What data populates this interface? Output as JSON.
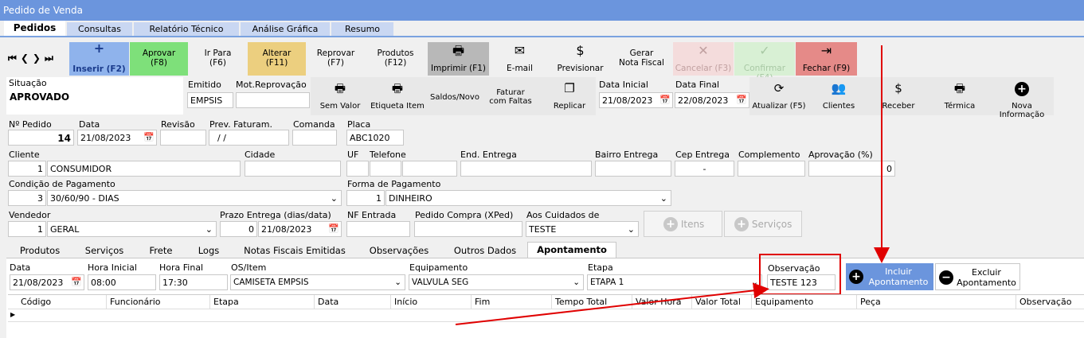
{
  "window": {
    "title": "Pedido de Venda"
  },
  "main_tabs": [
    "Pedidos",
    "Consultas",
    "Relatório Técnico",
    "Análise Gráfica",
    "Resumo"
  ],
  "toolbar": {
    "nav": [
      "⏮",
      "❮",
      "❯",
      "⏭"
    ],
    "insert": "Inserir (F2)",
    "approve_1": "Aprovar",
    "approve_2": "(F8)",
    "goto_1": "Ir Para",
    "goto_2": "(F6)",
    "alter_1": "Alterar",
    "alter_2": "(F11)",
    "reprove_1": "Reprovar",
    "reprove_2": "(F7)",
    "products_1": "Produtos",
    "products_2": "(F12)",
    "print": "Imprimir (F1)",
    "email": "E-mail",
    "forecast": "Previsionar",
    "nf_1": "Gerar",
    "nf_2": "Nota Fiscal",
    "cancel": "Cancelar (F3)",
    "confirm": "Confirmar (F4)",
    "close": "Fechar (F9)"
  },
  "status": {
    "situacao_label": "Situação",
    "situacao_value": "APROVADO",
    "emitido_label": "Emitido",
    "emitido_value": "EMPSIS",
    "motrep_label": "Mot.Reprovação",
    "motrep_value": ""
  },
  "actions": {
    "sem_valor": "Sem Valor",
    "etiqueta": "Etiqueta Item",
    "saldos": "Saldos/Novo",
    "faturar_1": "Faturar",
    "faturar_2": "com Faltas",
    "replicar": "Replicar",
    "data_inicial_label": "Data Inicial",
    "data_inicial": "21/08/2023",
    "data_final_label": "Data Final",
    "data_final": "22/08/2023",
    "atualizar": "Atualizar (F5)",
    "clientes": "Clientes",
    "receber": "Receber",
    "termica": "Térmica",
    "nova_info": "Nova Informação"
  },
  "order": {
    "numero_label": "Nº Pedido",
    "numero": "14",
    "data_label": "Data",
    "data": "21/08/2023",
    "revisao_label": "Revisão",
    "revisao": "",
    "prev_label": "Prev. Faturam.",
    "prev": "/ /",
    "comanda_label": "Comanda",
    "comanda": "",
    "placa_label": "Placa",
    "placa": "ABC1020"
  },
  "client": {
    "cliente_label": "Cliente",
    "cliente_id": "1",
    "cliente_nome": "CONSUMIDOR",
    "cidade_label": "Cidade",
    "uf_label": "UF",
    "telefone_label": "Telefone",
    "end_label": "End. Entrega",
    "bairro_label": "Bairro Entrega",
    "cep_label": "Cep Entrega",
    "cep": "-",
    "complemento_label": "Complemento",
    "aprovacao_label": "Aprovação (%)",
    "aprovacao": "0"
  },
  "payment": {
    "condicao_label": "Condição de Pagamento",
    "condicao_id": "3",
    "condicao": "30/60/90 - DIAS",
    "forma_label": "Forma de Pagamento",
    "forma_id": "1",
    "forma": "DINHEIRO"
  },
  "seller": {
    "vendedor_label": "Vendedor",
    "vendedor_id": "1",
    "vendedor": "GERAL",
    "prazo_label": "Prazo Entrega (dias/data)",
    "prazo_dias": "0",
    "prazo_data": "21/08/2023",
    "nf_label": "NF Entrada",
    "nf": "",
    "compra_label": "Pedido Compra (XPed)",
    "compra": "",
    "cuidados_label": "Aos Cuidados de",
    "cuidados": "TESTE",
    "itens": "Itens",
    "servicos": "Serviços"
  },
  "sub_tabs": [
    "Produtos",
    "Serviços",
    "Frete",
    "Logs",
    "Notas Fiscais Emitidas",
    "Observações",
    "Outros Dados",
    "Apontamento"
  ],
  "apont": {
    "data_label": "Data",
    "data": "21/08/2023",
    "hi_label": "Hora Inicial",
    "hi": "08:00",
    "hf_label": "Hora Final",
    "hf": "17:30",
    "os_label": "OS/Item",
    "os": "CAMISETA EMPSIS",
    "equip_label": "Equipamento",
    "equip": "VALVULA SEG",
    "etapa_label": "Etapa",
    "etapa": "ETAPA 1",
    "obs_label": "Observação",
    "obs": "TESTE 123",
    "incluir_1": "Incluir",
    "incluir_2": "Apontamento",
    "excluir_1": "Excluir",
    "excluir_2": "Apontamento"
  },
  "grid_columns": [
    "Código",
    "Funcionário",
    "Etapa",
    "Data",
    "Início",
    "Fim",
    "Tempo Total",
    "Valor Hora",
    "Valor Total",
    "Equipamento",
    "Peça",
    "Observação"
  ],
  "colors": {
    "title": "#6b95dd",
    "approve": "#7ee07a",
    "alter": "#eccf7f",
    "close": "#e58a88",
    "insert": "#8fb3ec",
    "annotation": "#e00000"
  }
}
